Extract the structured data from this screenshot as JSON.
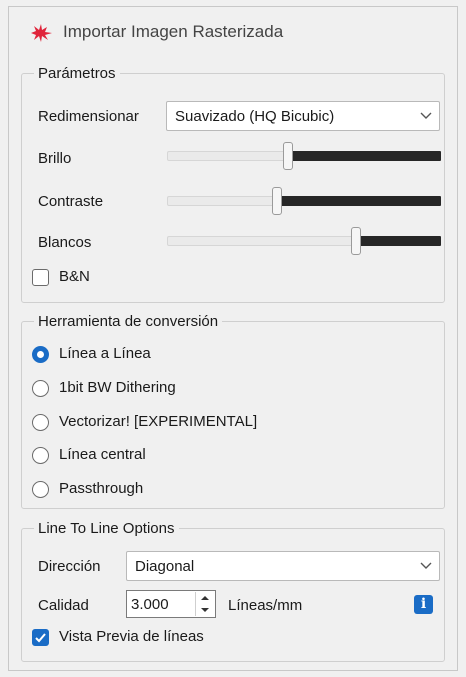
{
  "window": {
    "title": "Importar Imagen Rasterizada",
    "app_icon": "laser-spark-icon"
  },
  "parameters": {
    "legend": "Parámetros",
    "resize_label": "Redimensionar",
    "resize_value": "Suavizado (HQ Bicubic)",
    "sliders": [
      {
        "label": "Brillo",
        "level": 0.44
      },
      {
        "label": "Contraste",
        "level": 0.4
      },
      {
        "label": "Blancos",
        "level": 0.69
      }
    ],
    "bw_label": "B&N",
    "bw_checked": false
  },
  "tool": {
    "legend": "Herramienta de conversión",
    "options": [
      {
        "label": "Línea a Línea",
        "selected": true
      },
      {
        "label": "1bit BW Dithering",
        "selected": false
      },
      {
        "label": "Vectorizar! [EXPERIMENTAL]",
        "selected": false
      },
      {
        "label": "Línea central",
        "selected": false
      },
      {
        "label": "Passthrough",
        "selected": false
      }
    ]
  },
  "line_options": {
    "legend": "Line To Line Options",
    "direction_label": "Dirección",
    "direction_value": "Diagonal",
    "quality_label": "Calidad",
    "quality_value": "3.000",
    "quality_unit": "Líneas/mm",
    "info_glyph": "i",
    "preview_label": "Vista Previa de líneas",
    "preview_checked": true
  },
  "colors": {
    "accent": "#1a6cc6",
    "track_dark": "#262626",
    "icon_red": "#e0243a"
  }
}
